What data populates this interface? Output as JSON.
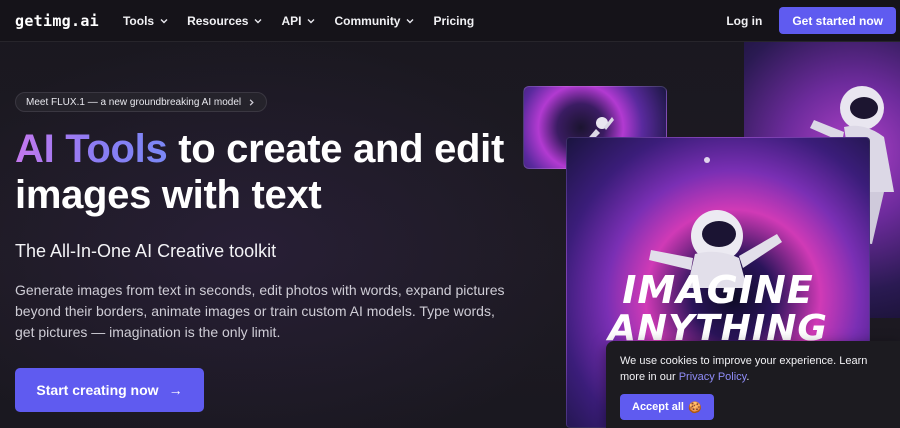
{
  "nav": {
    "logo": "getimg.ai",
    "items": [
      {
        "label": "Tools",
        "dropdown": true
      },
      {
        "label": "Resources",
        "dropdown": true
      },
      {
        "label": "API",
        "dropdown": true
      },
      {
        "label": "Community",
        "dropdown": true
      },
      {
        "label": "Pricing",
        "dropdown": false
      }
    ],
    "login": "Log in",
    "get_started": "Get started now"
  },
  "hero": {
    "badge": "Meet FLUX.1 — a new groundbreaking AI model",
    "headline_highlight": "AI Tools",
    "headline_rest": " to create and edit images with text",
    "subtitle": "The All-In-One AI Creative toolkit",
    "description": "Generate images from text in seconds, edit photos with words, expand pictures beyond their borders, animate images or train custom AI models. Type words, get pictures — imagination is the only limit.",
    "cta": "Start creating now",
    "cta_arrow": "→"
  },
  "images": {
    "main_line1": "IMAGINE",
    "main_line2": "ANYTHING"
  },
  "cookie": {
    "text": "We use cookies to improve your experience. Learn more in our ",
    "link": "Privacy Policy",
    "text_end": ".",
    "accept": "Accept all",
    "accept_emoji": "🍪"
  },
  "colors": {
    "accent": "#5f5bf0",
    "background": "#17151c",
    "gradient_start": "#c478ee",
    "gradient_end": "#7b88f5"
  }
}
